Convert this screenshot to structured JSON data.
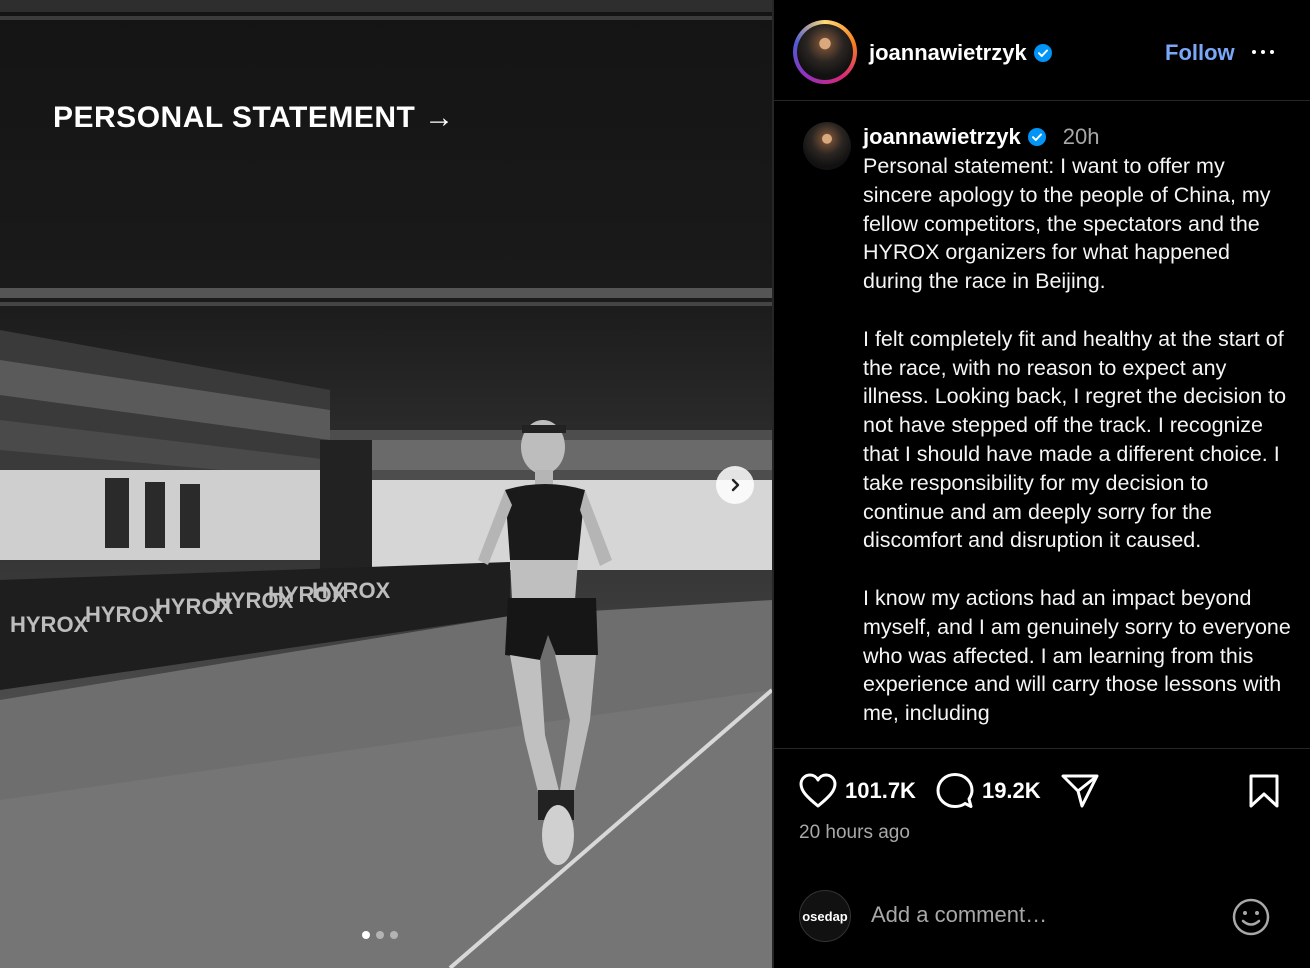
{
  "media": {
    "overlay_text": "PERSONAL STATEMENT →",
    "carousel": {
      "count": 3,
      "active": 1
    }
  },
  "header": {
    "username": "joannawietrzyk",
    "follow_label": "Follow"
  },
  "caption": {
    "username": "joannawietrzyk",
    "time": "20h",
    "text": "Personal statement: I want to offer my sincere apology to the people of China, my fellow competitors, the spectators and the HYROX organizers for what happened during the race in Beijing.\n\nI felt completely fit and healthy at the start of the race, with no reason to expect any illness. Looking back, I regret the decision to not have stepped off the track. I recognize that I should have made a different choice. I take responsibility for my decision to continue and am deeply sorry for the discomfort and disruption it caused.\n\nI know my actions had an impact beyond myself, and I am genuinely sorry to everyone who was affected. I am learning from this experience and will carry those lessons with me, including"
  },
  "actions": {
    "likes": "101.7K",
    "comments": "19.2K",
    "posted_ago": "20 hours ago"
  },
  "comment_box": {
    "avatar_text": "osedap",
    "placeholder": "Add a comment…"
  },
  "colors": {
    "link_blue": "#7aa7f8",
    "verified_blue": "#0095f6",
    "muted_text": "#a8a8a8"
  }
}
